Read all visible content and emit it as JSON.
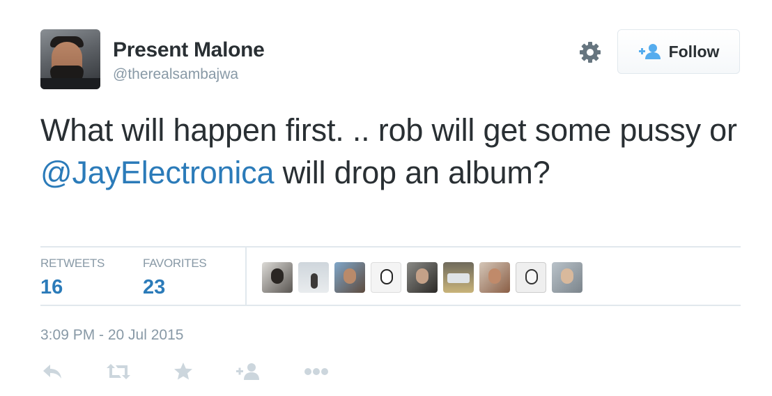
{
  "user": {
    "display_name": "Present Malone",
    "handle": "@therealsambajwa"
  },
  "header": {
    "follow_label": "Follow"
  },
  "tweet": {
    "text_before": "What will happen first. .. rob will get some pussy or ",
    "mention": "@JayElectronica",
    "text_after": " will drop an album?"
  },
  "stats": {
    "retweets_label": "RETWEETS",
    "retweets_count": "16",
    "favorites_label": "FAVORITES",
    "favorites_count": "23"
  },
  "timestamp": "3:09 PM - 20 Jul 2015",
  "icons": {
    "settings": "gear-icon",
    "follow": "add-user-icon",
    "reply": "reply-icon",
    "retweet": "retweet-icon",
    "favorite": "star-icon",
    "follow_action": "add-user-icon",
    "more": "more-dots-icon"
  },
  "colors": {
    "accent": "#2b7bb9",
    "text": "#292f33",
    "muted": "#8899a6",
    "action_icon": "#ccd6dd",
    "border": "#e1e8ed"
  }
}
